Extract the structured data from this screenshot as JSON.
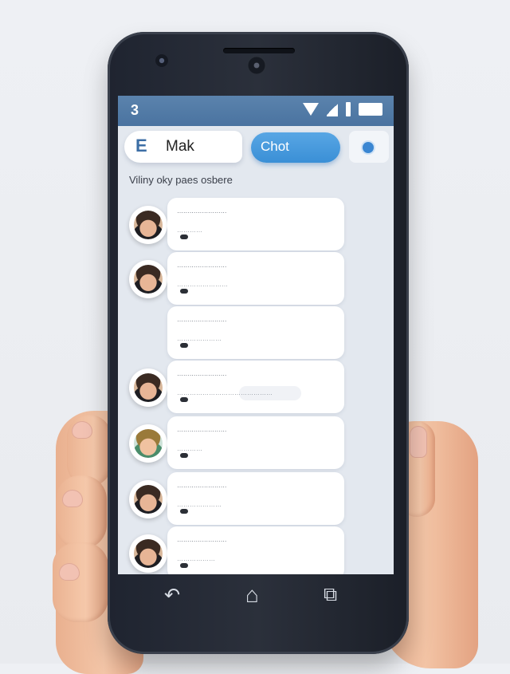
{
  "statusbar": {
    "left_label": "3"
  },
  "topbar": {
    "back_glyph": "E",
    "search_text": "Mak",
    "chat_label": "Chot"
  },
  "section_title": "Viliny oky paes osbere",
  "chats": [
    {
      "line1": "……………………",
      "line2": "…………",
      "avatar": "person-1"
    },
    {
      "line1": "……………………",
      "line2": "……………………",
      "avatar": "person-2"
    },
    {
      "line1": "……………………",
      "line2": "…………………",
      "avatar": ""
    },
    {
      "line1": "……………………",
      "line2": "………………………………………",
      "avatar": "person-3"
    },
    {
      "line1": "……………………",
      "line2": "…………",
      "avatar": "person-4"
    },
    {
      "line1": "……………………",
      "line2": "…………………",
      "avatar": "person-5"
    },
    {
      "line1": "……………………",
      "line2": "………………",
      "avatar": "person-6"
    }
  ],
  "nav": {
    "back_glyph": "↶",
    "home_glyph": "⌂",
    "recents_glyph": "⧉"
  },
  "colors": {
    "accent": "#3a8fd6",
    "statusbar": "#4a73a0"
  }
}
